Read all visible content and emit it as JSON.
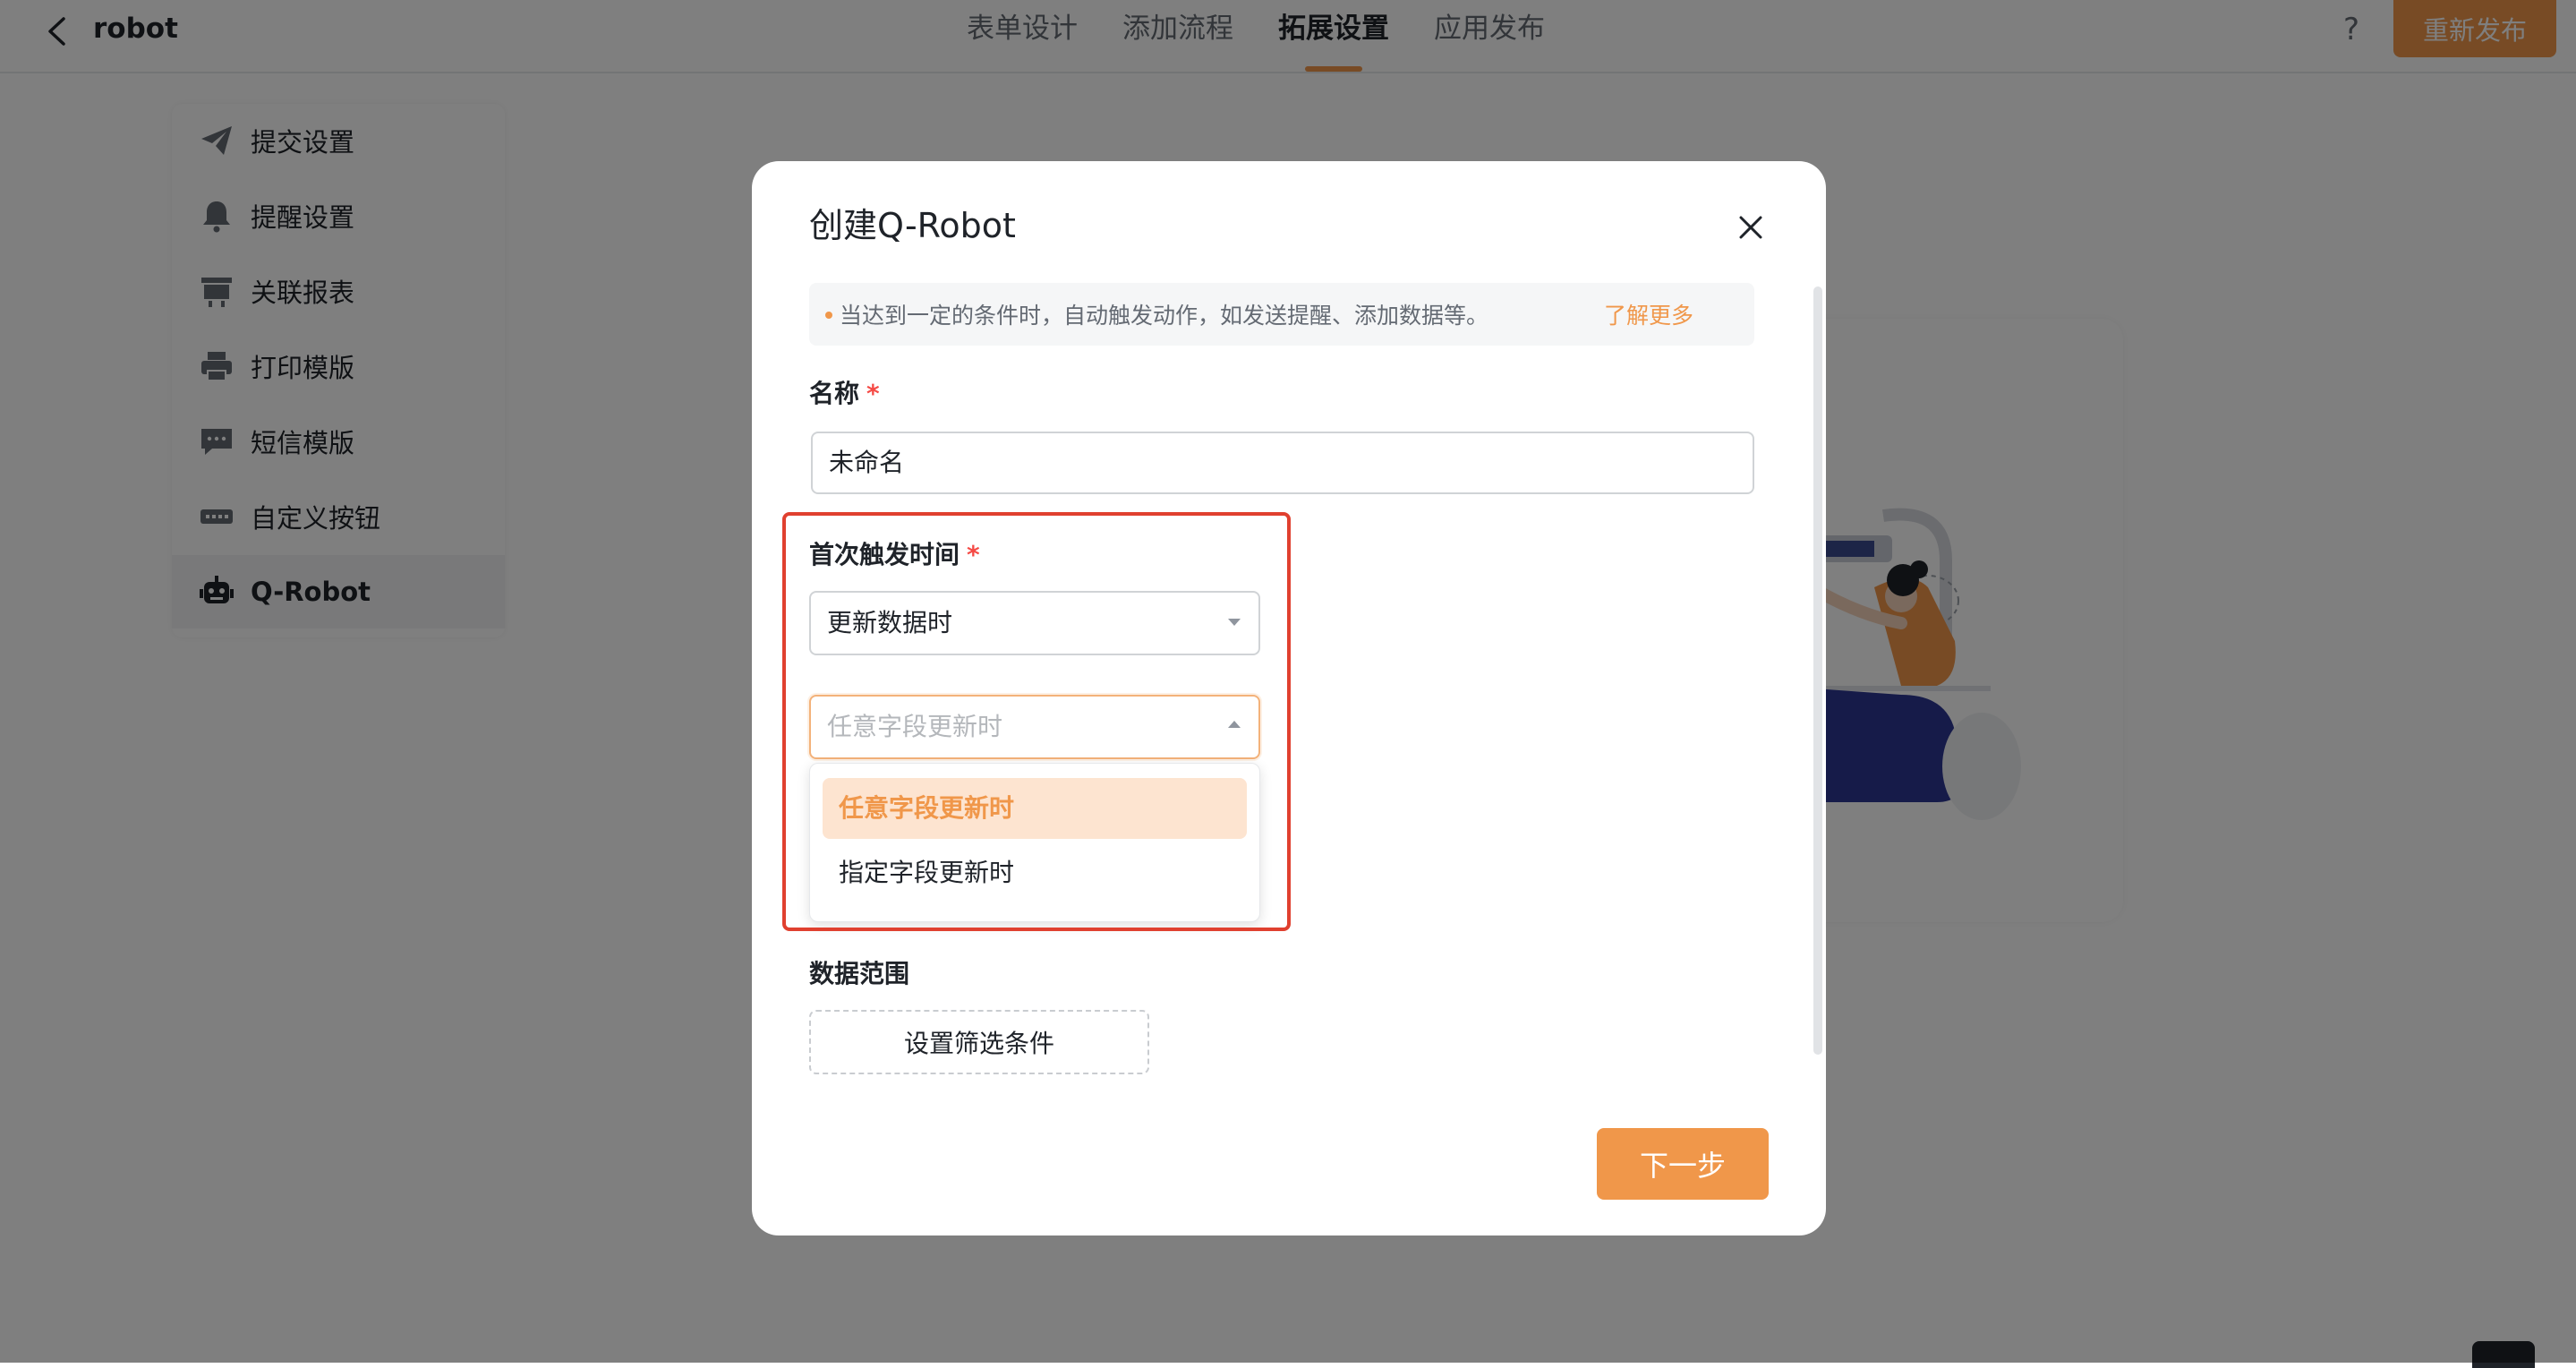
{
  "app": {
    "title": "robot"
  },
  "tabs": [
    {
      "label": "表单设计"
    },
    {
      "label": "添加流程"
    },
    {
      "label": "拓展设置"
    },
    {
      "label": "应用发布"
    }
  ],
  "header": {
    "help_label": "?",
    "republish_label": "重新发布"
  },
  "sidebar": {
    "items": [
      {
        "label": "提交设置"
      },
      {
        "label": "提醒设置"
      },
      {
        "label": "关联报表"
      },
      {
        "label": "打印模版"
      },
      {
        "label": "短信模版"
      },
      {
        "label": "自定义按钮"
      },
      {
        "label": "Q-Robot"
      }
    ]
  },
  "modal": {
    "title": "创建Q-Robot",
    "tip_text": "当达到一定的条件时，自动触发动作，如发送提醒、添加数据等。",
    "tip_link": "了解更多",
    "name_label": "名称",
    "required_mark": "*",
    "name_value": "未命名",
    "trigger_label": "首次触发时间",
    "trigger_select_value": "更新数据时",
    "field_select_placeholder": "任意字段更新时",
    "dropdown_options": [
      {
        "label": "任意字段更新时"
      },
      {
        "label": "指定字段更新时"
      }
    ],
    "data_range_label": "数据范围",
    "filter_button_label": "设置筛选条件",
    "next_button_label": "下一步"
  },
  "colors": {
    "accent": "#f0974a",
    "highlight_border": "#e0402f",
    "required": "#f54a45"
  }
}
